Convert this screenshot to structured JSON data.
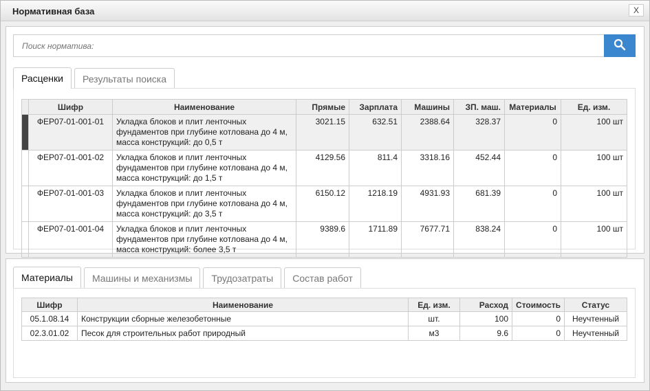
{
  "window": {
    "title": "Нормативная база",
    "close_label": "X"
  },
  "search": {
    "placeholder": "Поиск норматива:",
    "icon": "search-icon",
    "button_color": "#3a87d0"
  },
  "top_tabs": [
    {
      "label": "Расценки",
      "active": true
    },
    {
      "label": "Результаты поиска",
      "active": false
    }
  ],
  "rates_table": {
    "columns": [
      "Шифр",
      "Наименование",
      "Прямые",
      "Зарплата",
      "Машины",
      "ЗП. маш.",
      "Материалы",
      "Ед. изм."
    ],
    "rows": [
      {
        "code": "ФЕР07-01-001-01",
        "name": "Укладка блоков и плит ленточных фундаментов при глубине котлована до 4 м, масса конструкций: до 0,5 т",
        "direct": "3021.15",
        "salary": "632.51",
        "machines": "2388.64",
        "machine_salary": "328.37",
        "materials": "0",
        "unit": "100 шт",
        "selected": true
      },
      {
        "code": "ФЕР07-01-001-02",
        "name": "Укладка блоков и плит ленточных фундаментов при глубине котлована до 4 м, масса конструкций: до 1,5 т",
        "direct": "4129.56",
        "salary": "811.4",
        "machines": "3318.16",
        "machine_salary": "452.44",
        "materials": "0",
        "unit": "100 шт"
      },
      {
        "code": "ФЕР07-01-001-03",
        "name": "Укладка блоков и плит ленточных фундаментов при глубине котлована до 4 м, масса конструкций: до 3,5 т",
        "direct": "6150.12",
        "salary": "1218.19",
        "machines": "4931.93",
        "machine_salary": "681.39",
        "materials": "0",
        "unit": "100 шт"
      },
      {
        "code": "ФЕР07-01-001-04",
        "name": "Укладка блоков и плит ленточных фундаментов при глубине котлована до 4 м, масса конструкций: более 3,5 т",
        "direct": "9389.6",
        "salary": "1711.89",
        "machines": "7677.71",
        "machine_salary": "838.24",
        "materials": "0",
        "unit": "100 шт"
      }
    ]
  },
  "bottom_tabs": [
    {
      "label": "Материалы",
      "active": true
    },
    {
      "label": "Машины и механизмы"
    },
    {
      "label": "Трудозатраты"
    },
    {
      "label": "Состав работ"
    }
  ],
  "materials_table": {
    "columns": [
      "Шифр",
      "Наименование",
      "Ед. изм.",
      "Расход",
      "Стоимость",
      "Статус"
    ],
    "rows": [
      {
        "code": "05.1.08.14",
        "name": "Конструкции сборные железобетонные",
        "unit": "шт.",
        "consumption": "100",
        "cost": "0",
        "status": "Неучтенный"
      },
      {
        "code": "02.3.01.02",
        "name": "Песок для строительных работ природный",
        "unit": "м3",
        "consumption": "9.6",
        "cost": "0",
        "status": "Неучтенный"
      }
    ]
  }
}
